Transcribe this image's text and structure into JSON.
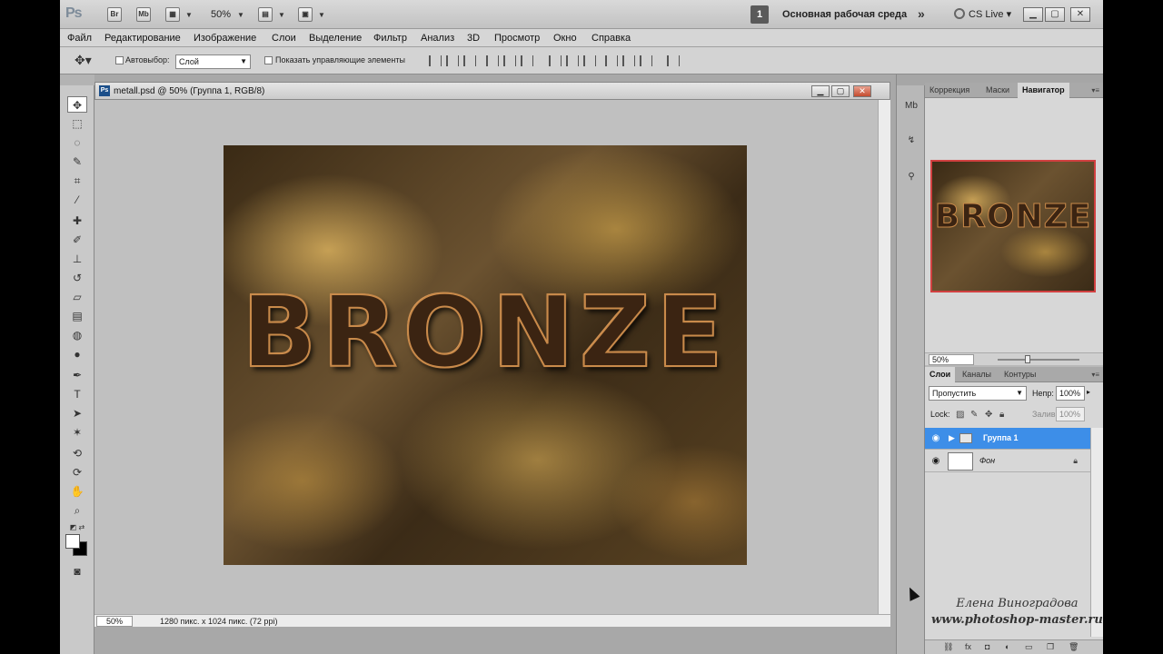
{
  "app": {
    "logo": "Ps",
    "bridge_label": "Br",
    "minibridge_label": "Mb",
    "zoom": "50%",
    "workspace_number": "1",
    "workspace_name": "Основная рабочая среда",
    "workspace_more": "»",
    "cs_live": "CS Live",
    "cs_live_caret": "▾"
  },
  "menu": [
    "Файл",
    "Редактирование",
    "Изображение",
    "Слои",
    "Выделение",
    "Фильтр",
    "Анализ",
    "3D",
    "Просмотр",
    "Окно",
    "Справка"
  ],
  "options": {
    "autoselect_label": "Автовыбор:",
    "autoselect_value": "Слой",
    "show_controls_label": "Показать управляющие элементы"
  },
  "document": {
    "title": "metall.psd @ 50% (Группа 1, RGB/8)",
    "image_text": "BRONZE",
    "status_zoom": "50%",
    "status_info": "1280 пикс. x 1024 пикс. (72 ppi)"
  },
  "navigator": {
    "tabs": [
      "Коррекция",
      "Маски",
      "Навигатор"
    ],
    "active_tab": "Навигатор",
    "zoom": "50%",
    "thumb_text": "BRONZE"
  },
  "layers": {
    "tabs": [
      "Слои",
      "Каналы",
      "Контуры"
    ],
    "blend_mode": "Пропустить",
    "opacity_label": "Непр:",
    "opacity": "100%",
    "lock_label": "Lock:",
    "fill_label": "Заливка:",
    "fill": "100%",
    "items": [
      {
        "name": "Группа 1",
        "selected": true
      },
      {
        "name": "Фон",
        "selected": false
      }
    ]
  },
  "watermark": {
    "author": "Елена Виноградова",
    "site": "www.photoshop-master.ru"
  },
  "colors": {
    "selection_blue": "#3d8ee8",
    "panel_bg": "#d7d7d7",
    "app_bg": "#a8a8a8",
    "navigator_frame": "#d14040"
  }
}
